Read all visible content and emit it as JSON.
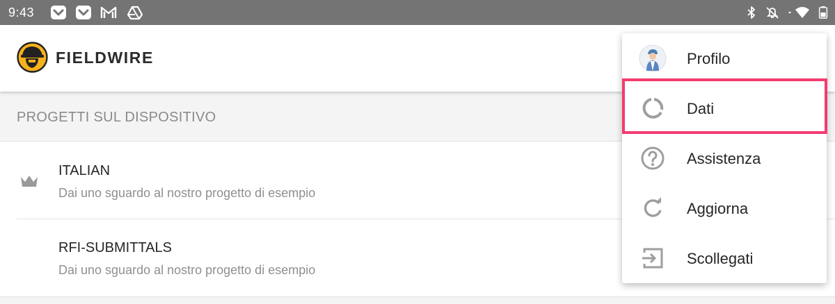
{
  "status_bar": {
    "time": "9:43",
    "left_icons": [
      "pocket-icon",
      "pocket-icon",
      "gmail-icon",
      "drive-icon"
    ],
    "right_icons": [
      "bluetooth-icon",
      "bell-off-icon",
      "wifi-icon",
      "battery-icon"
    ]
  },
  "app_bar": {
    "brand": "FIELDWIRE",
    "logo_icon": "fieldwire-logo-icon",
    "accent_color": "#f5b21b"
  },
  "section": {
    "title": "PROGETTI SUL DISPOSITIVO"
  },
  "projects": [
    {
      "name": "ITALIAN",
      "subtitle": "Dai uno sguardo al nostro progetto di esempio",
      "icon": "crown-icon"
    },
    {
      "name": "RFI-SUBMITTALS",
      "subtitle": "Dai uno sguardo al nostro progetto di esempio",
      "icon": ""
    }
  ],
  "menu": {
    "items": [
      {
        "label": "Profilo",
        "icon": "avatar-icon"
      },
      {
        "label": "Dati",
        "icon": "data-usage-icon"
      },
      {
        "label": "Assistenza",
        "icon": "help-icon"
      },
      {
        "label": "Aggiorna",
        "icon": "refresh-icon"
      },
      {
        "label": "Scollegati",
        "icon": "logout-icon"
      }
    ],
    "highlighted_item": "Dati",
    "highlight_color": "#f23c6f"
  }
}
